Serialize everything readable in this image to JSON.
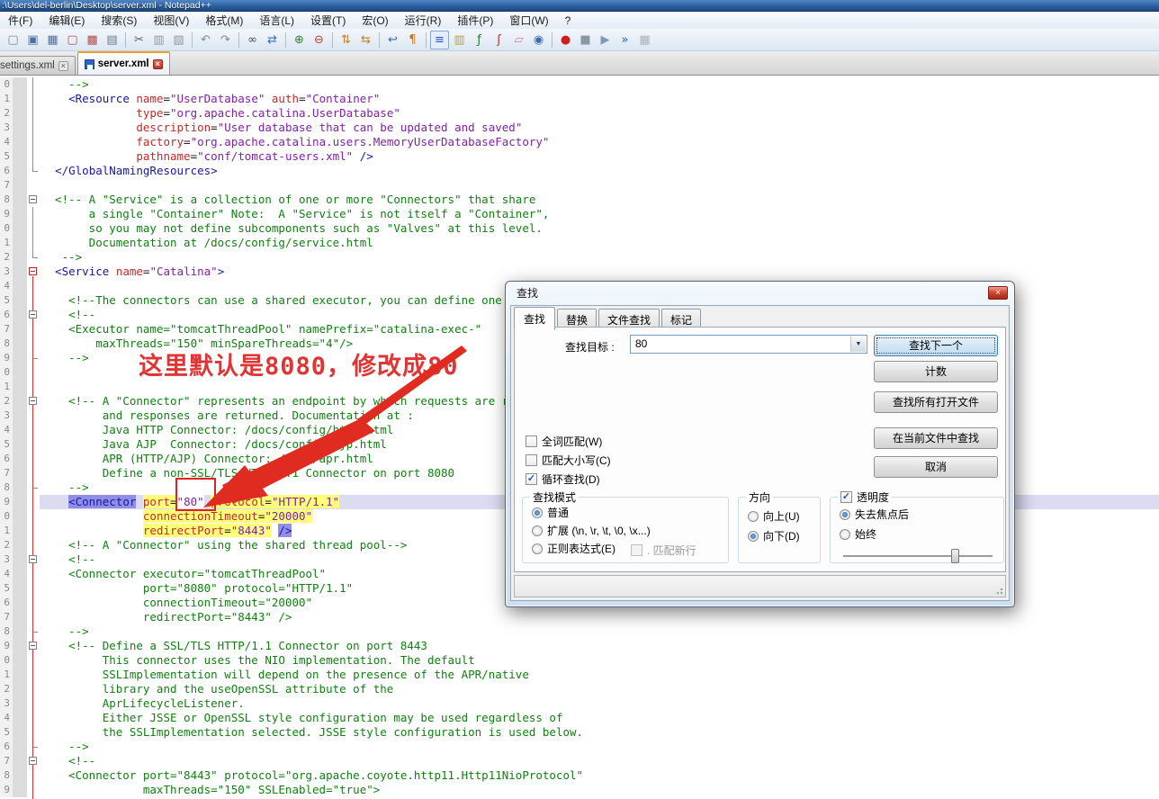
{
  "window": {
    "title": ":\\Users\\del-berlin\\Desktop\\server.xml - Notepad++"
  },
  "menu": {
    "items": [
      "件(F)",
      "编辑(E)",
      "搜索(S)",
      "视图(V)",
      "格式(M)",
      "语言(L)",
      "设置(T)",
      "宏(O)",
      "运行(R)",
      "插件(P)",
      "窗口(W)",
      "?"
    ]
  },
  "toolbar": {
    "items": [
      {
        "name": "new-file-icon",
        "g": "▢",
        "c": "#7a8aa0"
      },
      {
        "name": "save-icon",
        "g": "▣",
        "c": "#4a6fa5"
      },
      {
        "name": "save-all-icon",
        "g": "▦",
        "c": "#4a6fa5"
      },
      {
        "name": "close-file-icon",
        "g": "▢",
        "c": "#b05050"
      },
      {
        "name": "close-all-icon",
        "g": "▩",
        "c": "#b05050"
      },
      {
        "name": "print-icon",
        "g": "▤",
        "c": "#6a7a8a"
      },
      {
        "sep": true
      },
      {
        "name": "cut-icon",
        "g": "✂",
        "c": "#555e66"
      },
      {
        "name": "copy-icon",
        "g": "▥",
        "c": "#8a97a5"
      },
      {
        "name": "paste-icon",
        "g": "▧",
        "c": "#8a97a5"
      },
      {
        "sep": true
      },
      {
        "name": "undo-icon",
        "g": "↶",
        "c": "#7f8c99"
      },
      {
        "name": "redo-icon",
        "g": "↷",
        "c": "#7f8c99"
      },
      {
        "sep": true
      },
      {
        "name": "find-icon",
        "g": "∞",
        "c": "#3a4a5a"
      },
      {
        "name": "replace-icon",
        "g": "⇄",
        "c": "#3a6ab0"
      },
      {
        "sep": true
      },
      {
        "name": "zoom-in-icon",
        "g": "⊕",
        "c": "#3a7a3a"
      },
      {
        "name": "zoom-out-icon",
        "g": "⊖",
        "c": "#b04040"
      },
      {
        "sep": true
      },
      {
        "name": "sync-vertical-icon",
        "g": "⇅",
        "c": "#c08030"
      },
      {
        "name": "sync-horizontal-icon",
        "g": "⇆",
        "c": "#c08030"
      },
      {
        "sep": true
      },
      {
        "name": "word-wrap-icon",
        "g": "↩",
        "c": "#3a6ab0"
      },
      {
        "name": "show-all-chars-icon",
        "g": "¶",
        "c": "#c87820"
      },
      {
        "sep": true
      },
      {
        "name": "indent-guide-icon",
        "g": "≡",
        "c": "#2a58c0",
        "pressed": true
      },
      {
        "name": "doc-map-icon",
        "g": "▥",
        "c": "#c8a020"
      },
      {
        "name": "function-list-icon",
        "g": "ƒ",
        "c": "#2a7a2a"
      },
      {
        "name": "plugin-icon",
        "g": "ʃ",
        "c": "#c03030"
      },
      {
        "name": "folder-workspace-icon",
        "g": "▱",
        "c": "#d08090"
      },
      {
        "name": "monitoring-eye-icon",
        "g": "◉",
        "c": "#3a6ab0"
      },
      {
        "sep": true
      },
      {
        "name": "record-macro-icon",
        "g": "●",
        "c": "#cc2020"
      },
      {
        "name": "stop-macro-icon",
        "g": "■",
        "c": "#8a97a5"
      },
      {
        "name": "play-macro-icon",
        "g": "▶",
        "c": "#7f9ab5"
      },
      {
        "name": "run-macro-multiple-icon",
        "g": "»",
        "c": "#2a58c0"
      },
      {
        "name": "save-macro-icon",
        "g": "▦",
        "c": "#aab2ba"
      }
    ]
  },
  "tabs": [
    {
      "label": "settings.xml",
      "active": false
    },
    {
      "label": "server.xml",
      "active": true
    }
  ],
  "close_glyph": "×",
  "annotation": {
    "text": "这里默认是8080，修改成80",
    "color": "#e03535",
    "arrow_color": "#e02b20"
  },
  "editor": {
    "vlines": [
      {
        "from": 0,
        "to": 6.5,
        "color": "#909090"
      },
      {
        "from": 9,
        "to": 12.5,
        "color": "#909090"
      },
      {
        "from": 13.8,
        "to": 50.2,
        "color": "#e03030"
      }
    ],
    "lines": [
      {
        "n": "0",
        "s": [
          [
            "c",
            "    -->"
          ]
        ]
      },
      {
        "n": "1",
        "s": [
          [
            "d",
            "    "
          ],
          [
            "t",
            "<Resource"
          ],
          [
            "d",
            " "
          ],
          [
            "a",
            "name"
          ],
          [
            "d",
            "="
          ],
          [
            "v",
            "\"UserDatabase\""
          ],
          [
            "d",
            " "
          ],
          [
            "a",
            "auth"
          ],
          [
            "d",
            "="
          ],
          [
            "v",
            "\"Container\""
          ]
        ]
      },
      {
        "n": "2",
        "s": [
          [
            "d",
            "              "
          ],
          [
            "a",
            "type"
          ],
          [
            "d",
            "="
          ],
          [
            "v",
            "\"org.apache.catalina.UserDatabase\""
          ]
        ]
      },
      {
        "n": "3",
        "s": [
          [
            "d",
            "              "
          ],
          [
            "a",
            "description"
          ],
          [
            "d",
            "="
          ],
          [
            "v",
            "\"User database that can be updated and saved\""
          ]
        ]
      },
      {
        "n": "4",
        "s": [
          [
            "d",
            "              "
          ],
          [
            "a",
            "factory"
          ],
          [
            "d",
            "="
          ],
          [
            "v",
            "\"org.apache.catalina.users.MemoryUserDatabaseFactory\""
          ]
        ]
      },
      {
        "n": "5",
        "s": [
          [
            "d",
            "              "
          ],
          [
            "a",
            "pathname"
          ],
          [
            "d",
            "="
          ],
          [
            "v",
            "\"conf/tomcat-users.xml\""
          ],
          [
            "d",
            " "
          ],
          [
            "t",
            "/>"
          ]
        ]
      },
      {
        "n": "6",
        "f": "end",
        "s": [
          [
            "d",
            "  "
          ],
          [
            "t",
            "</GlobalNamingResources>"
          ]
        ]
      },
      {
        "n": "7",
        "s": []
      },
      {
        "n": "8",
        "f": "box",
        "s": [
          [
            "c",
            "  <!-- A \"Service\" is a collection of one or more \"Connectors\" that share"
          ]
        ]
      },
      {
        "n": "9",
        "s": [
          [
            "c",
            "       a single \"Container\" Note:  A \"Service\" is not itself a \"Container\","
          ]
        ]
      },
      {
        "n": "0",
        "s": [
          [
            "c",
            "       so you may not define subcomponents such as \"Valves\" at this level."
          ]
        ]
      },
      {
        "n": "1",
        "s": [
          [
            "c",
            "       Documentation at /docs/config/service.html"
          ]
        ]
      },
      {
        "n": "2",
        "f": "end",
        "s": [
          [
            "c",
            "   -->"
          ]
        ]
      },
      {
        "n": "3",
        "f": "boxr",
        "s": [
          [
            "d",
            "  "
          ],
          [
            "t",
            "<Service"
          ],
          [
            "d",
            " "
          ],
          [
            "a",
            "name"
          ],
          [
            "d",
            "="
          ],
          [
            "v",
            "\"Catalina\""
          ],
          [
            "t",
            ">"
          ]
        ]
      },
      {
        "n": "4",
        "s": []
      },
      {
        "n": "5",
        "s": [
          [
            "c",
            "    <!--The connectors can use a shared executor, you can define one or more named thread pools-->"
          ]
        ]
      },
      {
        "n": "6",
        "f": "box",
        "s": [
          [
            "c",
            "    <!--"
          ]
        ]
      },
      {
        "n": "7",
        "s": [
          [
            "c",
            "    <Executor name=\"tomcatThreadPool\" namePrefix=\"catalina-exec-\""
          ]
        ]
      },
      {
        "n": "8",
        "s": [
          [
            "c",
            "        maxThreads=\"150\" minSpareThreads=\"4\"/>"
          ]
        ]
      },
      {
        "n": "9",
        "f": "end",
        "s": [
          [
            "c",
            "    -->"
          ]
        ]
      },
      {
        "n": "0",
        "s": []
      },
      {
        "n": "1",
        "s": []
      },
      {
        "n": "2",
        "f": "box",
        "s": [
          [
            "c",
            "    <!-- A \"Connector\" represents an endpoint by which requests are received"
          ]
        ]
      },
      {
        "n": "3",
        "s": [
          [
            "c",
            "         and responses are returned. Documentation at :"
          ]
        ]
      },
      {
        "n": "4",
        "s": [
          [
            "c",
            "         Java HTTP Connector: /docs/config/http.html"
          ]
        ]
      },
      {
        "n": "5",
        "s": [
          [
            "c",
            "         Java AJP  Connector: /docs/config/ajp.html"
          ]
        ]
      },
      {
        "n": "6",
        "s": [
          [
            "c",
            "         APR (HTTP/AJP) Connector: /docs/apr.html"
          ]
        ]
      },
      {
        "n": "7",
        "s": [
          [
            "c",
            "         Define a non-SSL/TLS HTTP/1.1 Connector on port 8080"
          ]
        ]
      },
      {
        "n": "8",
        "f": "end",
        "s": [
          [
            "c",
            "    -->"
          ]
        ]
      },
      {
        "n": "9",
        "cur": true,
        "s": [
          [
            "d",
            "    "
          ],
          [
            "t hv",
            "<Connector"
          ],
          [
            "d",
            " "
          ],
          [
            "a m",
            "port"
          ],
          [
            "d m",
            "="
          ],
          [
            "v wb",
            "\"80\""
          ],
          [
            "d",
            " "
          ],
          [
            "a m",
            "protocol"
          ],
          [
            "d m",
            "="
          ],
          [
            "v m",
            "\"HTTP/1.1\""
          ]
        ]
      },
      {
        "n": "0",
        "s": [
          [
            "d",
            "               "
          ],
          [
            "a m",
            "connectionTimeout"
          ],
          [
            "d m",
            "="
          ],
          [
            "v m",
            "\"20000\""
          ]
        ]
      },
      {
        "n": "1",
        "s": [
          [
            "d",
            "               "
          ],
          [
            "a m",
            "redirectPort"
          ],
          [
            "d m",
            "="
          ],
          [
            "v m",
            "\"8443\""
          ],
          [
            "d",
            " "
          ],
          [
            "t hv",
            "/>"
          ]
        ]
      },
      {
        "n": "2",
        "s": [
          [
            "c",
            "    <!-- A \"Connector\" using the shared thread pool-->"
          ]
        ]
      },
      {
        "n": "3",
        "f": "box",
        "s": [
          [
            "c",
            "    <!--"
          ]
        ]
      },
      {
        "n": "4",
        "s": [
          [
            "c",
            "    <Connector executor=\"tomcatThreadPool\""
          ]
        ]
      },
      {
        "n": "5",
        "s": [
          [
            "c",
            "               port=\"8080\" protocol=\"HTTP/1.1\""
          ]
        ]
      },
      {
        "n": "6",
        "s": [
          [
            "c",
            "               connectionTimeout=\"20000\""
          ]
        ]
      },
      {
        "n": "7",
        "s": [
          [
            "c",
            "               redirectPort=\"8443\" />"
          ]
        ]
      },
      {
        "n": "8",
        "f": "end",
        "s": [
          [
            "c",
            "    -->"
          ]
        ]
      },
      {
        "n": "9",
        "f": "box",
        "s": [
          [
            "c",
            "    <!-- Define a SSL/TLS HTTP/1.1 Connector on port 8443"
          ]
        ]
      },
      {
        "n": "0",
        "s": [
          [
            "c",
            "         This connector uses the NIO implementation. The default"
          ]
        ]
      },
      {
        "n": "1",
        "s": [
          [
            "c",
            "         SSLImplementation will depend on the presence of the APR/native"
          ]
        ]
      },
      {
        "n": "2",
        "s": [
          [
            "c",
            "         library and the useOpenSSL attribute of the"
          ]
        ]
      },
      {
        "n": "3",
        "s": [
          [
            "c",
            "         AprLifecycleListener."
          ]
        ]
      },
      {
        "n": "4",
        "s": [
          [
            "c",
            "         Either JSSE or OpenSSL style configuration may be used regardless of"
          ]
        ]
      },
      {
        "n": "5",
        "s": [
          [
            "c",
            "         the SSLImplementation selected. JSSE style configuration is used below."
          ]
        ]
      },
      {
        "n": "6",
        "f": "end",
        "s": [
          [
            "c",
            "    -->"
          ]
        ]
      },
      {
        "n": "7",
        "f": "box",
        "s": [
          [
            "c",
            "    <!--"
          ]
        ]
      },
      {
        "n": "8",
        "s": [
          [
            "c",
            "    <Connector port=\"8443\" protocol=\"org.apache.coyote.http11.Http11NioProtocol\""
          ]
        ]
      },
      {
        "n": "9",
        "s": [
          [
            "c",
            "               maxThreads=\"150\" SSLEnabled=\"true\">"
          ]
        ]
      }
    ]
  },
  "dialog": {
    "title": "查找",
    "close_glyph": "×",
    "tabs": [
      "查找",
      "替换",
      "文件查找",
      "标记"
    ],
    "active_tab": "查找",
    "find_label": "查找目标 :",
    "find_value": "80",
    "combo_arrow": "▼",
    "buttons": [
      {
        "label": "查找下一个",
        "default": true
      },
      {
        "label": "计数"
      },
      {
        "label": "查找所有打开文件"
      },
      {
        "label": "在当前文件中查找"
      },
      {
        "label": "取消"
      }
    ],
    "checks": [
      {
        "label": "全词匹配(W)",
        "checked": false
      },
      {
        "label": "匹配大小写(C)",
        "checked": false
      },
      {
        "label": "循环查找(D)",
        "checked": true
      }
    ],
    "check_glyph": "✓",
    "groups": {
      "mode": {
        "title": "查找模式",
        "items": [
          {
            "label": "普通",
            "selected": true
          },
          {
            "label": "扩展 (\\n, \\r, \\t, \\0, \\x...)",
            "selected": false
          },
          {
            "label": "正则表达式(E)",
            "selected": false
          }
        ],
        "extra_check": {
          "label": ". 匹配新行",
          "checked": false,
          "disabled": true
        }
      },
      "direction": {
        "title": "方向",
        "items": [
          {
            "label": "向上(U)",
            "selected": false
          },
          {
            "label": "向下(D)",
            "selected": true
          }
        ]
      },
      "transparency": {
        "title": "透明度",
        "checked": true,
        "items": [
          {
            "label": "失去焦点后",
            "selected": true
          },
          {
            "label": "始终",
            "selected": false
          }
        ]
      }
    }
  }
}
